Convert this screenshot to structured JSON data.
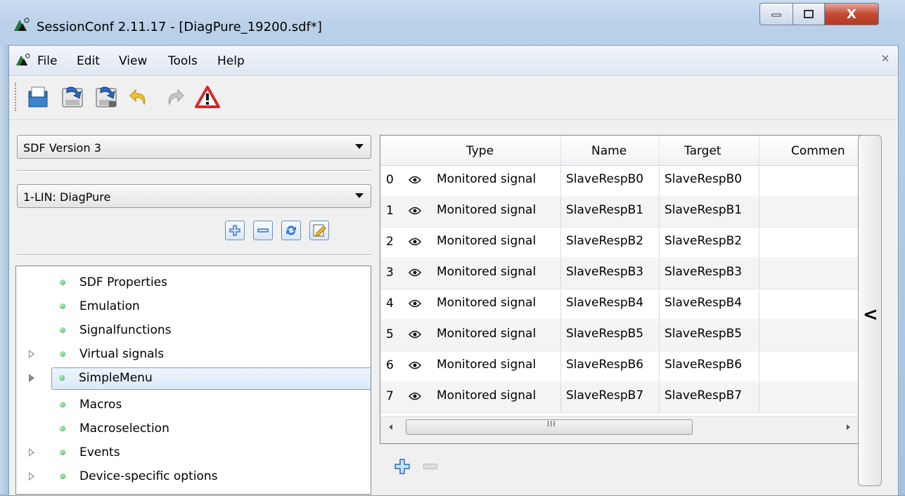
{
  "window": {
    "title": "SessionConf 2.11.17 - [DiagPure_19200.sdf*]",
    "controls": {
      "close": "X"
    }
  },
  "menubar": {
    "items": [
      "File",
      "Edit",
      "View",
      "Tools",
      "Help"
    ],
    "close": "×"
  },
  "toolbar": {
    "icons": [
      "open-file-icon",
      "save-icon",
      "save-as-icon",
      "undo-icon",
      "redo-icon",
      "warning-icon"
    ]
  },
  "left_pane": {
    "sdf_version": "SDF Version 3",
    "bus_select": "1-LIN: DiagPure",
    "buttons": [
      "add-icon",
      "remove-icon",
      "refresh-icon",
      "edit-icon"
    ],
    "tree": [
      {
        "label": "SDF Properties",
        "expandable": false,
        "selected": false
      },
      {
        "label": "Emulation",
        "expandable": false,
        "selected": false
      },
      {
        "label": "Signalfunctions",
        "expandable": false,
        "selected": false
      },
      {
        "label": "Virtual signals",
        "expandable": true,
        "selected": false
      },
      {
        "label": "SimpleMenu",
        "expandable": true,
        "selected": true
      },
      {
        "label": "Macros",
        "expandable": false,
        "selected": false
      },
      {
        "label": "Macroselection",
        "expandable": false,
        "selected": false
      },
      {
        "label": "Events",
        "expandable": true,
        "selected": false
      },
      {
        "label": "Device-specific options",
        "expandable": true,
        "selected": false
      }
    ]
  },
  "grid": {
    "headers": [
      "Type",
      "Name",
      "Target",
      "Commen"
    ],
    "rows": [
      {
        "idx": "0",
        "type": "Monitored signal",
        "name": "SlaveRespB0",
        "target": "SlaveRespB0",
        "comment": ""
      },
      {
        "idx": "1",
        "type": "Monitored signal",
        "name": "SlaveRespB1",
        "target": "SlaveRespB1",
        "comment": ""
      },
      {
        "idx": "2",
        "type": "Monitored signal",
        "name": "SlaveRespB2",
        "target": "SlaveRespB2",
        "comment": ""
      },
      {
        "idx": "3",
        "type": "Monitored signal",
        "name": "SlaveRespB3",
        "target": "SlaveRespB3",
        "comment": ""
      },
      {
        "idx": "4",
        "type": "Monitored signal",
        "name": "SlaveRespB4",
        "target": "SlaveRespB4",
        "comment": ""
      },
      {
        "idx": "5",
        "type": "Monitored signal",
        "name": "SlaveRespB5",
        "target": "SlaveRespB5",
        "comment": ""
      },
      {
        "idx": "6",
        "type": "Monitored signal",
        "name": "SlaveRespB6",
        "target": "SlaveRespB6",
        "comment": ""
      },
      {
        "idx": "7",
        "type": "Monitored signal",
        "name": "SlaveRespB7",
        "target": "SlaveRespB7",
        "comment": ""
      }
    ],
    "scroll_grip": "III"
  },
  "side_panel": {
    "chevron": "<"
  },
  "colors": {
    "accent": "#3a7bd5",
    "warning": "#d8282a",
    "tree_dot": "#3cb657"
  }
}
